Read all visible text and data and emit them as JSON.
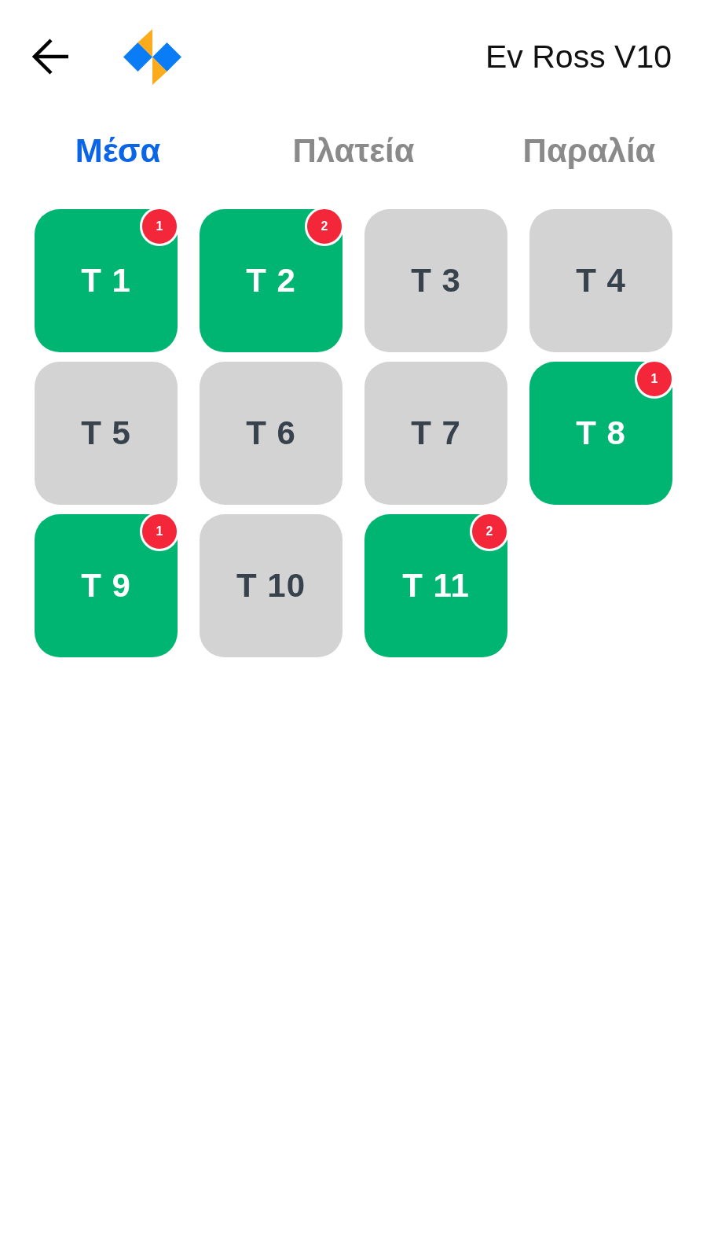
{
  "header": {
    "title": "Ev Ross V10"
  },
  "tabs": [
    {
      "label": "Μέσα",
      "selected": true
    },
    {
      "label": "Πλατεία",
      "selected": false
    },
    {
      "label": "Παραλία",
      "selected": false
    }
  ],
  "tables": [
    {
      "label": "T 1",
      "occupied": true,
      "badge": "1"
    },
    {
      "label": "T 2",
      "occupied": true,
      "badge": "2"
    },
    {
      "label": "T 3",
      "occupied": false
    },
    {
      "label": "T 4",
      "occupied": false
    },
    {
      "label": "T 5",
      "occupied": false
    },
    {
      "label": "T 6",
      "occupied": false
    },
    {
      "label": "T 7",
      "occupied": false
    },
    {
      "label": "T 8",
      "occupied": true,
      "badge": "1"
    },
    {
      "label": "T 9",
      "occupied": true,
      "badge": "1"
    },
    {
      "label": "T 10",
      "occupied": false
    },
    {
      "label": "T 11",
      "occupied": true,
      "badge": "2"
    }
  ]
}
